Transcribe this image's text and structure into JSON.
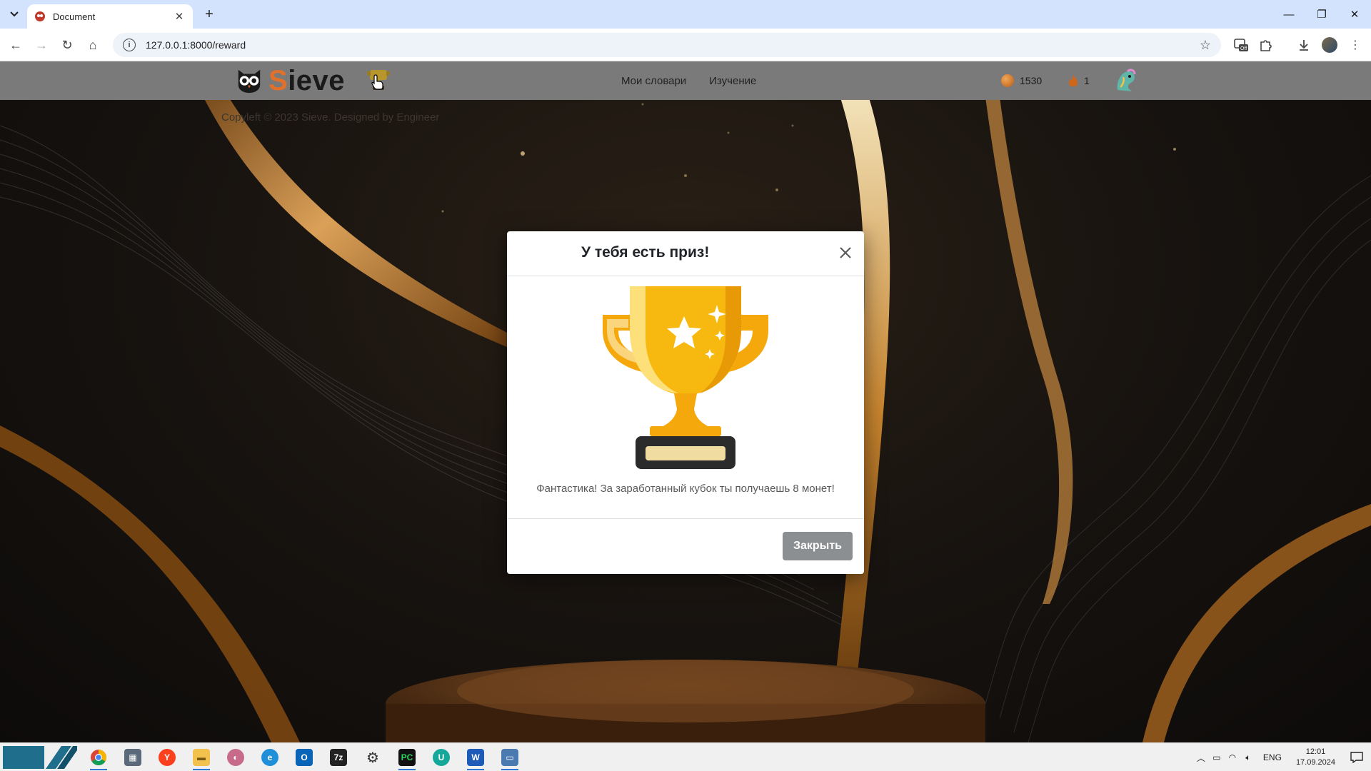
{
  "browser": {
    "tab_title": "Document",
    "url": "127.0.0.1:8000/reward"
  },
  "site": {
    "logo_text_first": "S",
    "logo_text_rest": "ieve",
    "nav": [
      {
        "label": "Мои словари"
      },
      {
        "label": "Изучение"
      }
    ],
    "coins": "1530",
    "streak": "1",
    "copyright": "Copyleft © 2023 Sieve. Designed by Engineer"
  },
  "modal": {
    "title": "У тебя есть приз!",
    "message": "Фантастика! За заработанный кубок ты получаешь 8 монет!",
    "close_button": "Закрыть"
  },
  "taskbar": {
    "language": "ENG",
    "time": "12:01",
    "date": "17.09.2024"
  },
  "colors": {
    "accent_orange": "#e0702a",
    "trophy_gold": "#f5b10b",
    "header_gray": "#7a7a7a",
    "button_gray": "#8c8f92"
  }
}
